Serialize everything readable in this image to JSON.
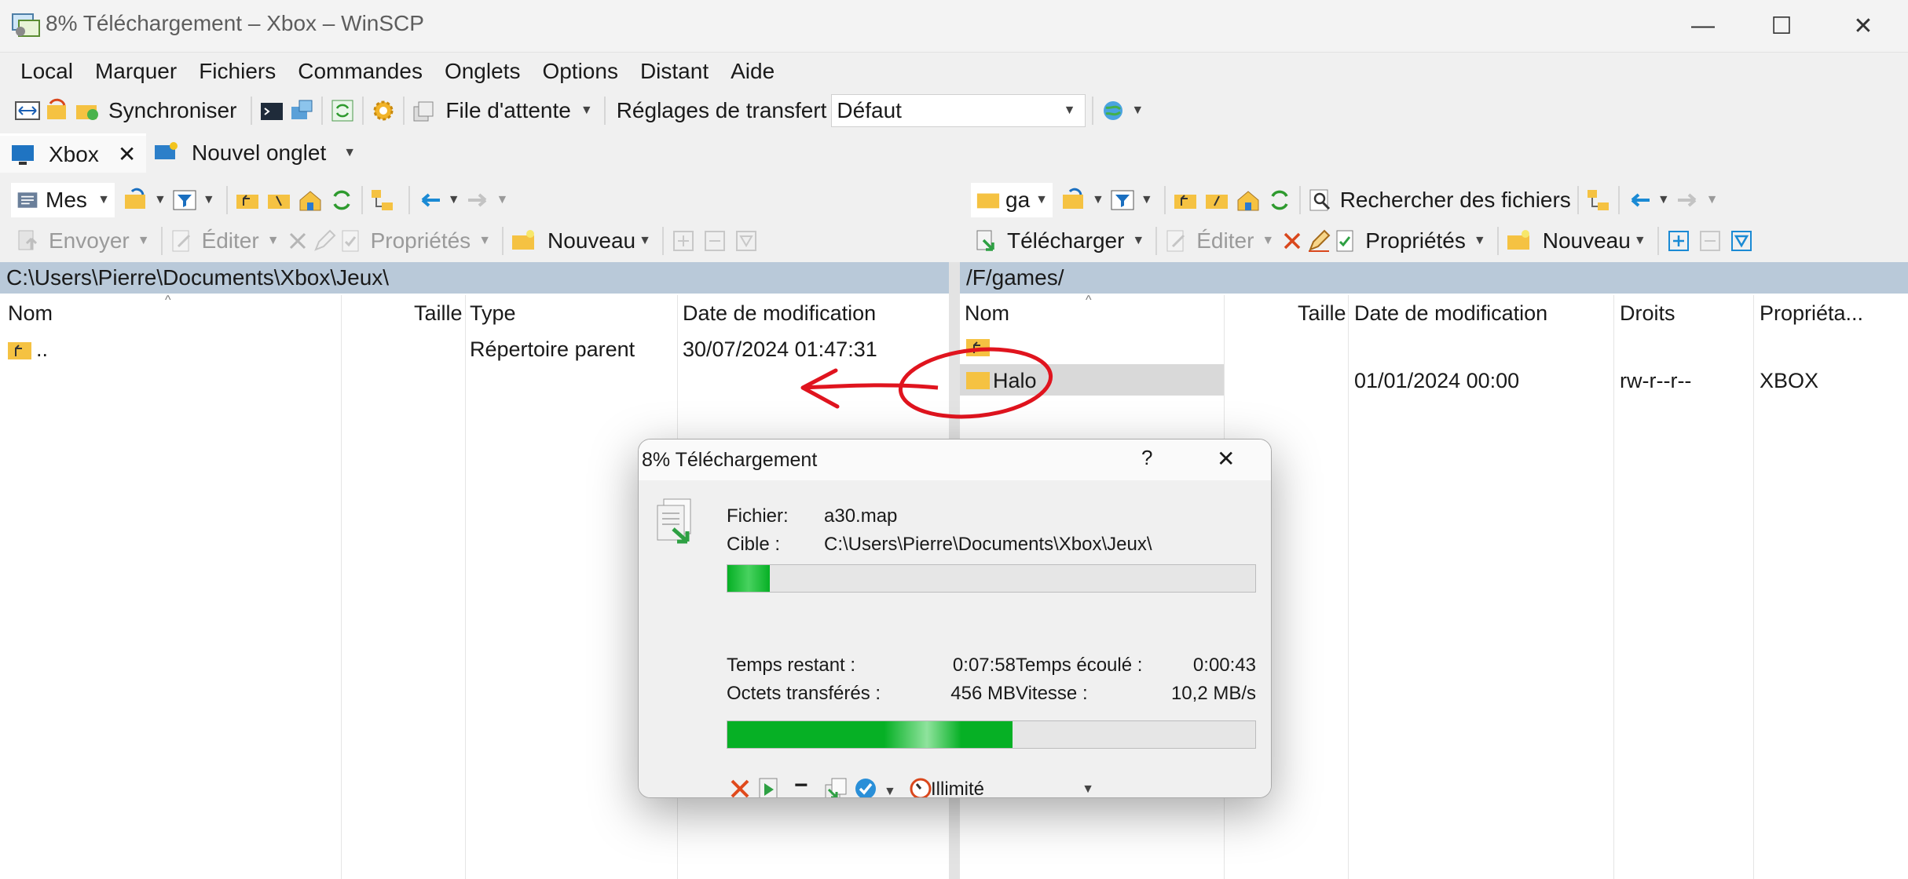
{
  "window": {
    "title": "8% Téléchargement – Xbox – WinSCP",
    "minimize": "—",
    "maximize": "☐",
    "close": "✕"
  },
  "menu": [
    "Local",
    "Marquer",
    "Fichiers",
    "Commandes",
    "Onglets",
    "Options",
    "Distant",
    "Aide"
  ],
  "toolbar": {
    "synchronize": "Synchroniser",
    "queue": "File d'attente",
    "transfer_settings_label": "Réglages de transfert",
    "transfer_settings_value": "Défaut"
  },
  "tabs": {
    "active": "Xbox",
    "close_glyph": "✕",
    "new_tab": "Nouvel onglet"
  },
  "left_panel": {
    "location": "Mes",
    "actions": {
      "send": "Envoyer",
      "edit": "Éditer",
      "properties": "Propriétés",
      "new": "Nouveau"
    },
    "path": "C:\\Users\\Pierre\\Documents\\Xbox\\Jeux\\",
    "columns": [
      "Nom",
      "Taille",
      "Type",
      "Date de modification"
    ],
    "rows": [
      {
        "name": "..",
        "size": "",
        "type": "Répertoire parent",
        "modified": "30/07/2024 01:47:31"
      }
    ]
  },
  "right_panel": {
    "location": "ga",
    "search": "Rechercher des fichiers",
    "actions": {
      "download": "Télécharger",
      "edit": "Éditer",
      "properties": "Propriétés",
      "new": "Nouveau"
    },
    "path": "/F/games/",
    "columns": [
      "Nom",
      "Taille",
      "Date de modification",
      "Droits",
      "Propriéta..."
    ],
    "rows": [
      {
        "name": "",
        "size": "",
        "modified": "",
        "rights": "",
        "owner": ""
      },
      {
        "name": "Halo",
        "size": "",
        "modified": "01/01/2024 00:00",
        "rights": "rw-r--r--",
        "owner": "XBOX"
      }
    ]
  },
  "dialog": {
    "title": "8% Téléchargement",
    "help": "?",
    "close": "✕",
    "file_label": "Fichier:",
    "file_value": "a30.map",
    "target_label": "Cible :",
    "target_value": "C:\\Users\\Pierre\\Documents\\Xbox\\Jeux\\",
    "file_progress": 0.08,
    "time_left_label": "Temps restant :",
    "time_left": "0:07:58",
    "time_elapsed_label": "Temps écoulé :",
    "time_elapsed": "0:00:43",
    "bytes_label": "Octets transférés :",
    "bytes": "456 MB",
    "speed_label": "Vitesse :",
    "speed": "10,2 MB/s",
    "total_progress": 0.54,
    "speed_limit": "Illimité"
  },
  "colors": {
    "accent_green": "#06b025",
    "annotation_red": "#e0141e",
    "path_bar": "#b9c9d9"
  }
}
